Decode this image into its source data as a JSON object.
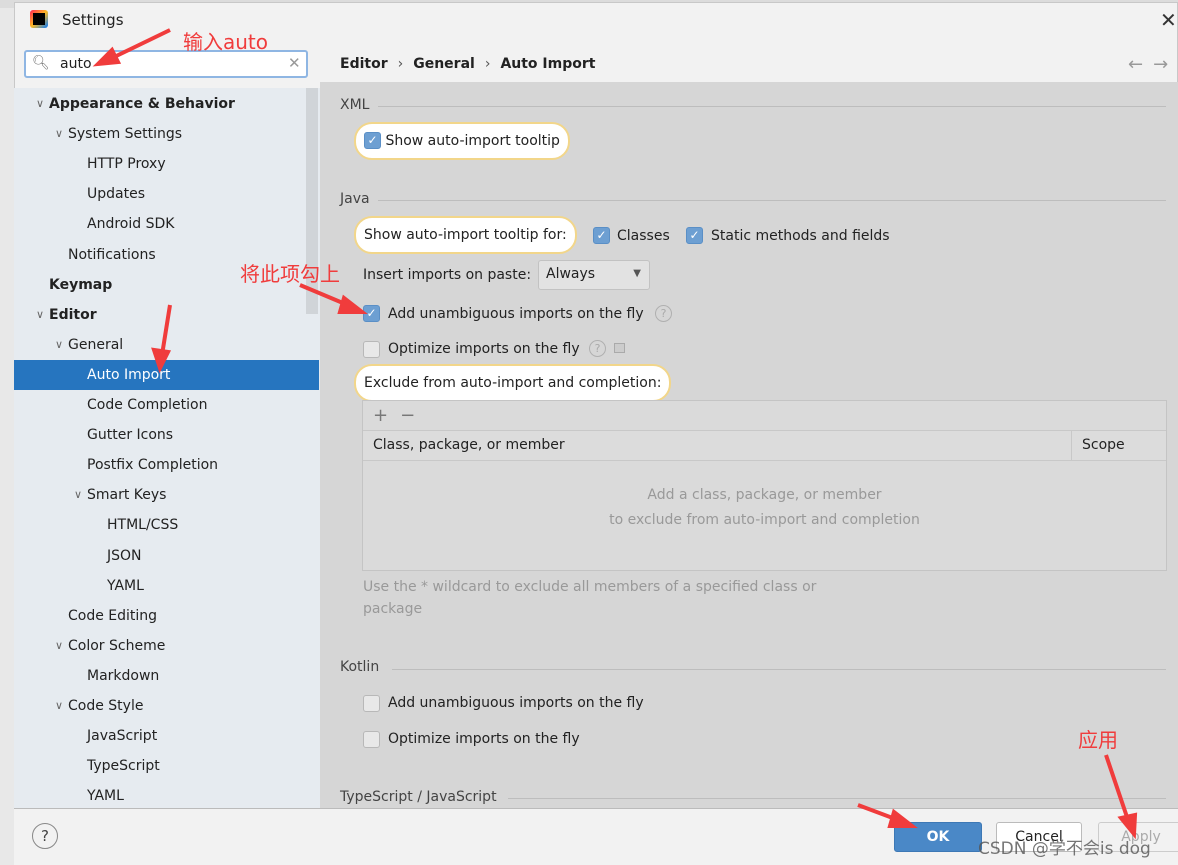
{
  "window": {
    "title": "Settings",
    "close": "✕"
  },
  "search": {
    "value": "auto",
    "icon": "search-icon",
    "clear": "✕"
  },
  "tree": [
    {
      "label": "Appearance & Behavior",
      "level": 0,
      "expanded": true,
      "bold": true
    },
    {
      "label": "System Settings",
      "level": 1,
      "expanded": true
    },
    {
      "label": "HTTP Proxy",
      "level": 2
    },
    {
      "label": "Updates",
      "level": 2
    },
    {
      "label": "Android SDK",
      "level": 2
    },
    {
      "label": "Notifications",
      "level": 1
    },
    {
      "label": "Keymap",
      "level": 0,
      "bold": true
    },
    {
      "label": "Editor",
      "level": 0,
      "expanded": true,
      "bold": true
    },
    {
      "label": "General",
      "level": 1,
      "expanded": true
    },
    {
      "label": "Auto Import",
      "level": 2,
      "selected": true
    },
    {
      "label": "Code Completion",
      "level": 2
    },
    {
      "label": "Gutter Icons",
      "level": 2
    },
    {
      "label": "Postfix Completion",
      "level": 2
    },
    {
      "label": "Smart Keys",
      "level": 2,
      "expanded": true
    },
    {
      "label": "HTML/CSS",
      "level": 3
    },
    {
      "label": "JSON",
      "level": 3
    },
    {
      "label": "YAML",
      "level": 3
    },
    {
      "label": "Code Editing",
      "level": 1
    },
    {
      "label": "Color Scheme",
      "level": 1,
      "expanded": true
    },
    {
      "label": "Markdown",
      "level": 2
    },
    {
      "label": "Code Style",
      "level": 1,
      "expanded": true
    },
    {
      "label": "JavaScript",
      "level": 2
    },
    {
      "label": "TypeScript",
      "level": 2
    },
    {
      "label": "YAML",
      "level": 2
    }
  ],
  "breadcrumb": [
    "Editor",
    "General",
    "Auto Import"
  ],
  "nav": {
    "back": "←",
    "forward": "→"
  },
  "xml": {
    "section": "XML",
    "tooltip_label": "Show auto-import tooltip",
    "tooltip_checked": true
  },
  "java": {
    "section": "Java",
    "tooltip_for": "Show auto-import tooltip for:",
    "classes": {
      "label": "Classes",
      "checked": true
    },
    "static": {
      "label": "Static methods and fields",
      "checked": true
    },
    "paste_label": "Insert imports on paste:",
    "paste_value": "Always",
    "unambiguous": {
      "label": "Add unambiguous imports on the fly",
      "checked": true
    },
    "optimize": {
      "label": "Optimize imports on the fly",
      "checked": false
    },
    "exclude_label": "Exclude from auto-import and completion:",
    "table": {
      "add": "+",
      "remove": "−",
      "col1": "Class, package, or member",
      "col2": "Scope",
      "empty1": "Add a class, package, or member",
      "empty2": "to exclude from auto-import and completion"
    },
    "hint1": "Use the * wildcard to exclude all members of a specified class or",
    "hint2": "package"
  },
  "kotlin": {
    "section": "Kotlin",
    "unambiguous": {
      "label": "Add unambiguous imports on the fly",
      "checked": false
    },
    "optimize": {
      "label": "Optimize imports on the fly",
      "checked": false
    }
  },
  "ts": {
    "section": "TypeScript / JavaScript"
  },
  "footer": {
    "help": "?",
    "ok": "OK",
    "cancel": "Cancel",
    "apply": "Apply"
  },
  "annotations": {
    "search": "输入auto",
    "check": "将此项勾上",
    "apply": "应用",
    "color": "#f03c3c"
  },
  "watermark": "CSDN @学不会is dog",
  "colors": {
    "selection": "#2675bf",
    "ok": "#4a88c7",
    "highlight": "#f2d68a"
  }
}
